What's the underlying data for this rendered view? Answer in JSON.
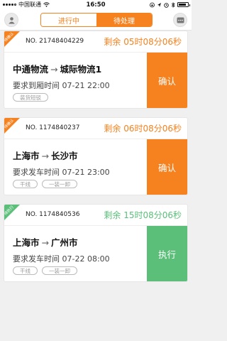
{
  "status_bar": {
    "carrier": "中国联通",
    "time": "16:50"
  },
  "header": {
    "tabs": [
      {
        "label": "进行中",
        "active": false
      },
      {
        "label": "待处理",
        "active": true
      }
    ]
  },
  "colors": {
    "accent": "#f5821f",
    "green": "#5bbf7a"
  },
  "orders": [
    {
      "corner_label": "待确认",
      "number": "NO. 21748404229",
      "remaining": "剩余 05时08分06秒",
      "from": "中通物流",
      "arrow": "→",
      "to": "城际物流1",
      "requirement": "要求到厢时间 07-21 22:00",
      "tags": [
        "装货短驳"
      ],
      "action": "确认"
    },
    {
      "corner_label": "待确认",
      "number": "NO. 1174840237",
      "remaining": "剩余 06时08分06秒",
      "from": "上海市",
      "arrow": "→",
      "to": "长沙市",
      "requirement": "要求发车时间 07-21 23:00",
      "tags": [
        "干线",
        "一装一卸"
      ],
      "action": "确认"
    },
    {
      "corner_label": "待执行",
      "number": "NO. 1174840536",
      "remaining": "剩余 15时08分06秒",
      "from": "上海市",
      "arrow": "→",
      "to": "广州市",
      "requirement": "要求发车时间 07-22 08:00",
      "tags": [
        "干线",
        "一装一卸"
      ],
      "action": "执行"
    }
  ]
}
